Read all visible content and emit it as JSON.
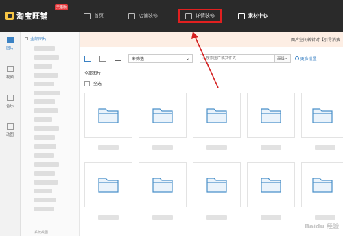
{
  "app": {
    "name": "淘宝旺铺",
    "badge": "天猫版"
  },
  "nav": {
    "items": [
      {
        "label": "首页",
        "icon": "home-icon"
      },
      {
        "label": "店铺装修",
        "icon": "store-icon"
      },
      {
        "label": "详情装修",
        "icon": "detail-page-icon"
      },
      {
        "label": "素材中心",
        "icon": "folder-icon"
      }
    ],
    "active_index": 3,
    "highlighted_index": 2
  },
  "rail": {
    "items": [
      {
        "label": "图片",
        "icon": "image-icon"
      },
      {
        "label": "视频",
        "icon": "video-icon"
      },
      {
        "label": "音乐",
        "icon": "music-icon"
      },
      {
        "label": "动图",
        "icon": "gif-icon"
      }
    ],
    "active_index": 0
  },
  "tree": {
    "root_label": "全部图片",
    "bottom_label": "系统截图"
  },
  "notice": {
    "text": "图片空间转针对【引导消费"
  },
  "toolbar": {
    "filter_value": "未筛选",
    "search_placeholder": "搜索图片或文件夹",
    "advanced_label": "高级",
    "more_settings_label": "更多设置"
  },
  "content": {
    "breadcrumb": "全部图片",
    "select_all_label": "全选"
  },
  "colors": {
    "accent": "#3b82c4",
    "topbar": "#2a2a2a",
    "highlight": "#e02020",
    "notice_bg": "#fdeee4"
  },
  "watermark": "Baidu 经验"
}
